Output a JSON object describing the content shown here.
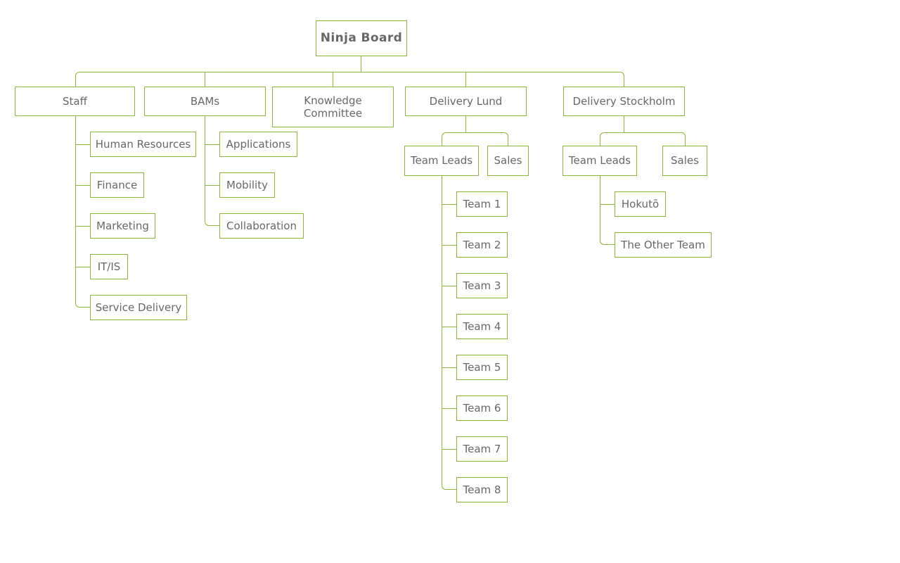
{
  "diagram": {
    "title": "Ninja Board organization chart",
    "accent_color": "#8fb23c",
    "text_color": "#676767",
    "background": "#ffffff"
  },
  "nodes": {
    "root": {
      "label": "Ninja Board"
    },
    "level1": [
      {
        "label": "Staff"
      },
      {
        "label": "BAMs"
      },
      {
        "label": "Knowledge\nCommittee"
      },
      {
        "label": "Delivery Lund"
      },
      {
        "label": "Delivery Stockholm"
      }
    ],
    "staff_children": [
      {
        "label": "Human Resources"
      },
      {
        "label": "Finance"
      },
      {
        "label": "Marketing"
      },
      {
        "label": "IT/IS"
      },
      {
        "label": "Service Delivery"
      }
    ],
    "bams_children": [
      {
        "label": "Applications"
      },
      {
        "label": "Mobility"
      },
      {
        "label": "Collaboration"
      }
    ],
    "lund_children": [
      {
        "label": "Team Leads"
      },
      {
        "label": "Sales"
      }
    ],
    "lund_team_leads_children": [
      {
        "label": "Team 1"
      },
      {
        "label": "Team 2"
      },
      {
        "label": "Team 3"
      },
      {
        "label": "Team 4"
      },
      {
        "label": "Team 5"
      },
      {
        "label": "Team 6"
      },
      {
        "label": "Team 7"
      },
      {
        "label": "Team 8"
      }
    ],
    "stockholm_children": [
      {
        "label": "Team Leads"
      },
      {
        "label": "Sales"
      }
    ],
    "stockholm_team_leads_children": [
      {
        "label": "Hokutō"
      },
      {
        "label": "The Other Team"
      }
    ]
  }
}
